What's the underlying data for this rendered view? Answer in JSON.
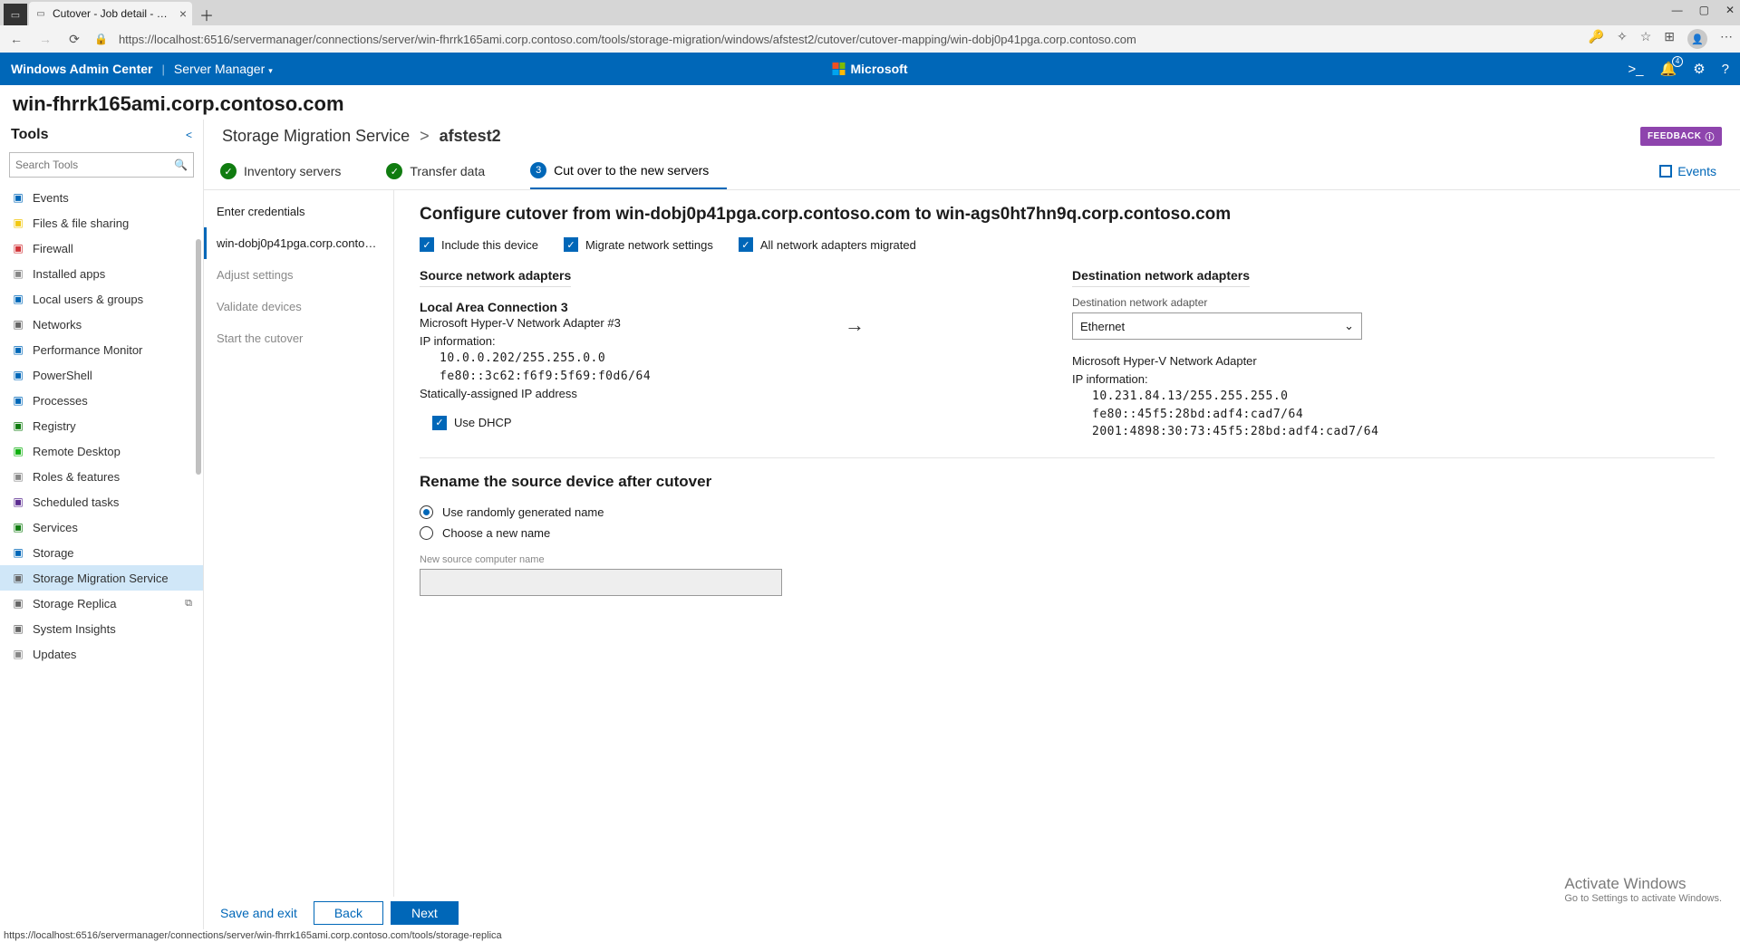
{
  "browser": {
    "tab_title": "Cutover - Job detail - Storage Mi",
    "url": "https://localhost:6516/servermanager/connections/server/win-fhrrk165ami.corp.contoso.com/tools/storage-migration/windows/afstest2/cutover/cutover-mapping/win-dobj0p41pga.corp.contoso.com"
  },
  "wac": {
    "product": "Windows Admin Center",
    "module": "Server Manager",
    "brand": "Microsoft",
    "notif_count": "4"
  },
  "server": {
    "name": "win-fhrrk165ami.corp.contoso.com"
  },
  "tools": {
    "title": "Tools",
    "search_ph": "Search Tools",
    "items": [
      {
        "label": "Events",
        "color": "#0067b8"
      },
      {
        "label": "Files & file sharing",
        "color": "#f2c811"
      },
      {
        "label": "Firewall",
        "color": "#d13438"
      },
      {
        "label": "Installed apps",
        "color": "#888"
      },
      {
        "label": "Local users & groups",
        "color": "#0067b8"
      },
      {
        "label": "Networks",
        "color": "#666"
      },
      {
        "label": "Performance Monitor",
        "color": "#0067b8"
      },
      {
        "label": "PowerShell",
        "color": "#0067b8"
      },
      {
        "label": "Processes",
        "color": "#0067b8"
      },
      {
        "label": "Registry",
        "color": "#107c10"
      },
      {
        "label": "Remote Desktop",
        "color": "#10b010"
      },
      {
        "label": "Roles & features",
        "color": "#888"
      },
      {
        "label": "Scheduled tasks",
        "color": "#5c2d91"
      },
      {
        "label": "Services",
        "color": "#107c10"
      },
      {
        "label": "Storage",
        "color": "#0067b8"
      },
      {
        "label": "Storage Migration Service",
        "color": "#666"
      },
      {
        "label": "Storage Replica",
        "color": "#666"
      },
      {
        "label": "System Insights",
        "color": "#666"
      },
      {
        "label": "Updates",
        "color": "#888"
      }
    ],
    "selected_idx": 15,
    "popout_idx": 16
  },
  "breadcrumb": {
    "root": "Storage Migration Service",
    "current": "afstest2",
    "feedback": "FEEDBACK"
  },
  "steps": {
    "s1": "Inventory servers",
    "s2": "Transfer data",
    "s3_num": "3",
    "s3": "Cut over to the new servers",
    "events": "Events"
  },
  "wiz_nav": {
    "items": [
      {
        "label": "Enter credentials",
        "state": "enabled"
      },
      {
        "label": "win-dobj0p41pga.corp.contoso.com...",
        "state": "active"
      },
      {
        "label": "Adjust settings",
        "state": "disabled"
      },
      {
        "label": "Validate devices",
        "state": "disabled"
      },
      {
        "label": "Start the cutover",
        "state": "disabled"
      }
    ]
  },
  "config": {
    "heading": "Configure cutover from win-dobj0p41pga.corp.contoso.com to win-ags0ht7hn9q.corp.contoso.com",
    "chk_include": "Include this device",
    "chk_migrate": "Migrate network settings",
    "chk_all": "All network adapters migrated",
    "src_sect": "Source network adapters",
    "src_name": "Local Area Connection 3",
    "src_adapter": "Microsoft Hyper-V Network Adapter #3",
    "ip_label": "IP information:",
    "src_ip1": "10.0.0.202/255.255.0.0",
    "src_ip2": "fe80::3c62:f6f9:5f69:f0d6/64",
    "src_static": "Statically-assigned IP address",
    "chk_dhcp": "Use DHCP",
    "dst_sect": "Destination network adapters",
    "dst_label": "Destination network adapter",
    "dst_select": "Ethernet",
    "dst_adapter": "Microsoft Hyper-V Network Adapter",
    "dst_ip1": "10.231.84.13/255.255.255.0",
    "dst_ip2": "fe80::45f5:28bd:adf4:cad7/64",
    "dst_ip3": "2001:4898:30:73:45f5:28bd:adf4:cad7/64",
    "rename_head": "Rename the source device after cutover",
    "radio1": "Use randomly generated name",
    "radio2": "Choose a new name",
    "new_name_label": "New source computer name"
  },
  "footer": {
    "save": "Save and exit",
    "back": "Back",
    "next": "Next"
  },
  "activate": {
    "t1": "Activate Windows",
    "t2": "Go to Settings to activate Windows."
  },
  "status": "https://localhost:6516/servermanager/connections/server/win-fhrrk165ami.corp.contoso.com/tools/storage-replica"
}
